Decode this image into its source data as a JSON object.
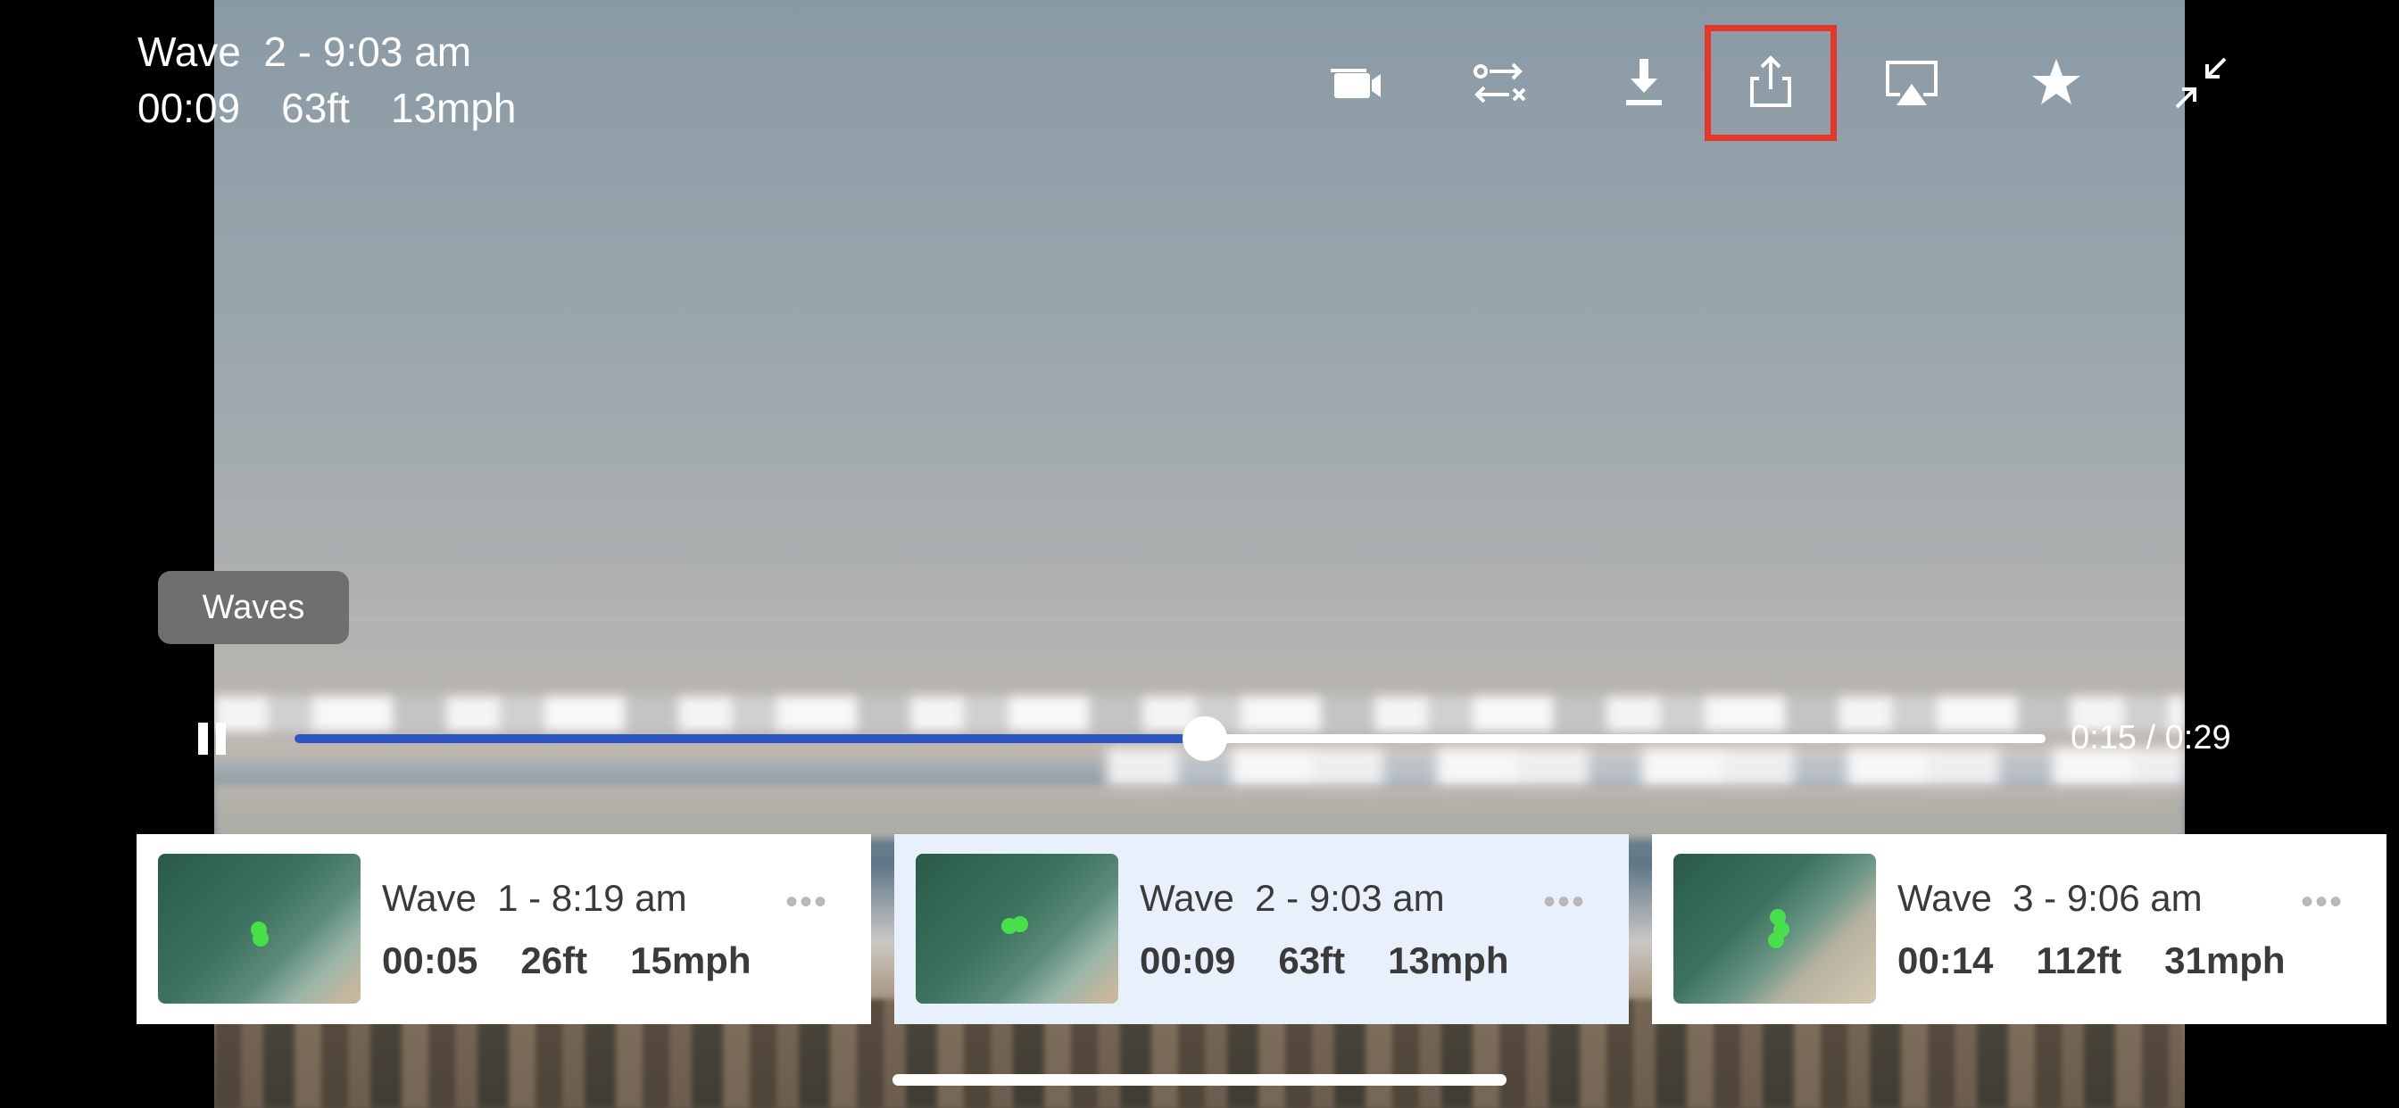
{
  "header": {
    "title": "Wave  2 - 9:03 am",
    "duration": "00:09",
    "distance": "63ft",
    "speed": "13mph"
  },
  "toolbar": [
    {
      "icon": "video-camera-icon"
    },
    {
      "icon": "swap-compare-icon"
    },
    {
      "icon": "download-icon"
    },
    {
      "icon": "share-icon",
      "highlighted": true
    },
    {
      "icon": "airplay-icon"
    },
    {
      "icon": "star-icon"
    },
    {
      "icon": "collapse-fullscreen-icon"
    }
  ],
  "tooltip": {
    "label": "Waves"
  },
  "player": {
    "time_display": "0:15 / 0:29",
    "progress": 0.52,
    "state": "playing"
  },
  "waves": [
    {
      "title": "Wave  1 - 8:19 am",
      "duration": "00:05",
      "distance": "26ft",
      "speed": "15mph",
      "more": "•••",
      "active": false
    },
    {
      "title": "Wave  2 - 9:03 am",
      "duration": "00:09",
      "distance": "63ft",
      "speed": "13mph",
      "more": "•••",
      "active": true
    },
    {
      "title": "Wave  3 - 9:06 am",
      "duration": "00:14",
      "distance": "112ft",
      "speed": "31mph",
      "more": "•••",
      "active": false
    }
  ],
  "colors": {
    "highlight": "#e3372b",
    "progress_fill": "#2f55c4",
    "active_card": "#e8f0fb",
    "track_marker": "#47e04a"
  }
}
